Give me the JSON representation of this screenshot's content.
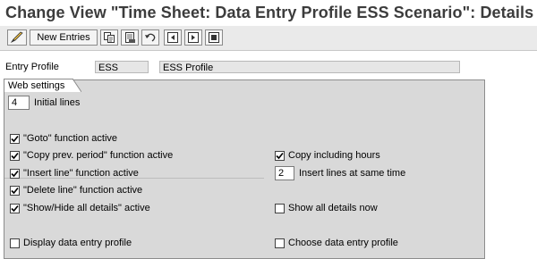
{
  "title": "Change View \"Time Sheet: Data Entry Profile ESS Scenario\": Details",
  "toolbar": {
    "new_entries_label": "New Entries",
    "icons": [
      "edit-icon",
      "copy-icon",
      "delete-icon",
      "undo-icon",
      "previous-entry-icon",
      "next-entry-icon",
      "select-all-icon"
    ]
  },
  "entry_profile": {
    "label": "Entry Profile",
    "code": "ESS",
    "description": "ESS Profile"
  },
  "web_settings": {
    "tab_label": "Web settings",
    "initial_lines_value": "4",
    "initial_lines_label": "Initial lines",
    "insert_lines_value": "2",
    "insert_lines_label": "Insert lines at same time",
    "checkboxes": [
      {
        "label": "\"Goto\" function active",
        "checked": true
      },
      {
        "label": "\"Copy prev. period\" function active",
        "checked": true
      },
      {
        "label": "Copy including hours",
        "checked": true
      },
      {
        "label": "\"Insert line\" function active",
        "checked": true
      },
      {
        "label": "\"Delete line\" function active",
        "checked": true
      },
      {
        "label": "\"Show/Hide all details\" active",
        "checked": true
      },
      {
        "label": "Show all details now",
        "checked": false
      },
      {
        "label": "Display data entry profile",
        "checked": false
      },
      {
        "label": "Choose data entry profile",
        "checked": false
      }
    ]
  },
  "colors": {
    "title": "#3c3c3c",
    "toolbar_bg": "#eaeaea",
    "group_bg": "#d9d9d9",
    "readonly_field": "#e6e6e6"
  }
}
